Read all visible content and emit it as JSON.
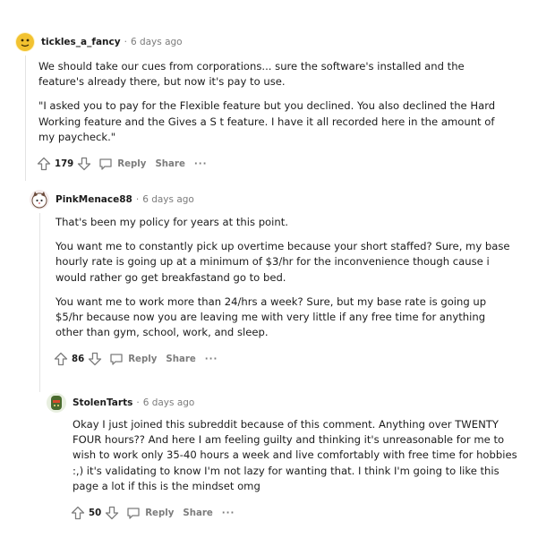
{
  "comments": [
    {
      "username": "tickles_a_fancy",
      "separator": "·",
      "timestamp": "6 days ago",
      "avatar_icon": "yellow-blob-avatar-icon",
      "paragraphs": [
        "We should take our cues from corporations... sure the software's installed and the feature's already there, but now it's pay to use.",
        "\"I asked you to pay for the Flexible feature but you declined. You also declined the Hard Working feature and the Gives a S    t feature. I have it all recorded here in the amount of my paycheck.\""
      ],
      "votes": "179",
      "reply_label": "Reply",
      "share_label": "Share",
      "more_label": "···"
    },
    {
      "username": "PinkMenace88",
      "separator": "·",
      "timestamp": "6 days ago",
      "avatar_icon": "cat-avatar-icon",
      "paragraphs": [
        "That's been my policy for years at this point.",
        "You want me to constantly pick up overtime because your short staffed? Sure, my base hourly rate is going up at a minimum of $3/hr for the inconvenience though cause i would rather go get breakfastand go to bed.",
        "You want me to work more than 24/hrs a week? Sure, but my base rate is going up $5/hr because now you are leaving me with very little if any free time for anything other than gym, school, work, and sleep."
      ],
      "votes": "86",
      "reply_label": "Reply",
      "share_label": "Share",
      "more_label": "···"
    },
    {
      "username": "StolenTarts",
      "separator": "·",
      "timestamp": "6 days ago",
      "avatar_icon": "green-character-avatar-icon",
      "paragraphs": [
        "Okay I just joined this subreddit because of this comment. Anything over TWENTY FOUR hours?? And here I am feeling guilty and thinking it's unreasonable for me to wish to work only 35-40 hours a week and live comfortably with free time for hobbies :,) it's validating to know I'm not lazy for wanting that. I think I'm going to like this page a lot if this is the mindset omg"
      ],
      "votes": "50",
      "reply_label": "Reply",
      "share_label": "Share",
      "more_label": "···"
    }
  ],
  "colors": {
    "text": "#1c1c1c",
    "meta": "#7c7c7c",
    "avatar1": "#f2c230",
    "avatar3": "#4a6b2e",
    "thread_line": "#e3e3e3"
  }
}
